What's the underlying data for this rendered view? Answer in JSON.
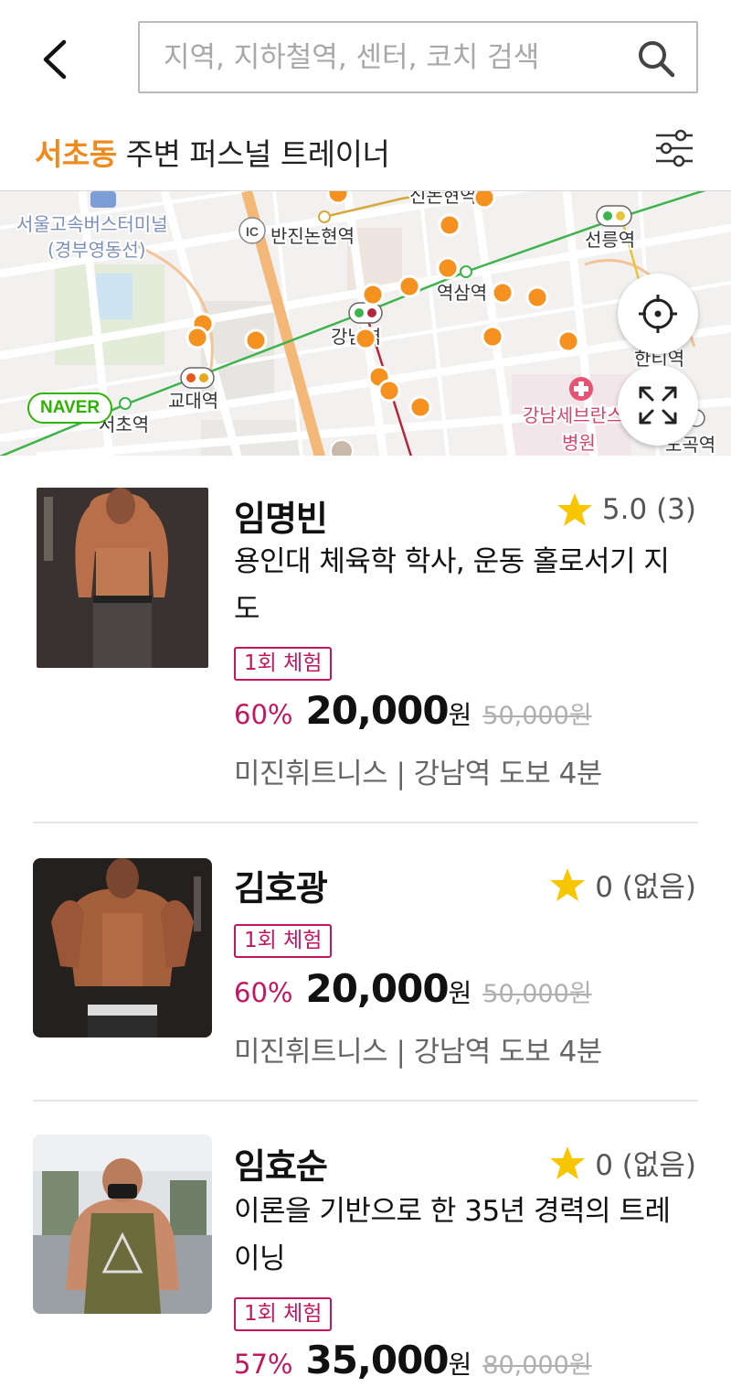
{
  "header": {
    "search_placeholder": "지역, 지하철역, 센터, 코치 검색"
  },
  "area": {
    "name": "서초동",
    "suffix": " 주변 퍼스널 트레이너"
  },
  "map": {
    "brand": "NAVER",
    "labels": {
      "bus_terminal_1": "서울고속버스터미널",
      "bus_terminal_2": "(경부영동선)",
      "ic": "IC",
      "bannonhyeon": "반진논현역",
      "sinnonhyeon": "신논현역",
      "seolleung": "선릉역",
      "yeoksam": "역삼역",
      "gangnam": "강남역",
      "hanti": "한티역",
      "gyodae": "교대역",
      "seocho": "서초역",
      "severance_1": "강남세브란스",
      "severance_2": "병원",
      "dogok": "도곡역"
    },
    "colors": {
      "marker": "#f5911e",
      "line2": "#3cb44b",
      "line9": "#d5a83a",
      "sinbundang": "#b5263d",
      "road": "#f3b878"
    }
  },
  "trainers": [
    {
      "name": "임명빈",
      "rating": "5.0 (3)",
      "description": "용인대 체육학 학사, 운동 홀로서기 지도",
      "badge": "1회 체험",
      "discount": "60%",
      "price": "20,000",
      "currency": "원",
      "original_price": "50,000원",
      "location": "미진휘트니스 | 강남역 도보 4분"
    },
    {
      "name": "김호광",
      "rating": "0 (없음)",
      "badge": "1회 체험",
      "discount": "60%",
      "price": "20,000",
      "currency": "원",
      "original_price": "50,000원",
      "location": "미진휘트니스 | 강남역 도보 4분"
    },
    {
      "name": "임효순",
      "rating": "0 (없음)",
      "description": "이론을 기반으로 한 35년 경력의 트레이닝",
      "badge": "1회 체험",
      "discount": "57%",
      "price": "35,000",
      "currency": "원",
      "original_price": "80,000원"
    }
  ],
  "icons": {
    "back": "chevron-left-icon",
    "search": "search-icon",
    "filter": "sliders-icon",
    "locate": "crosshair-icon",
    "expand": "expand-icon",
    "star": "star-icon"
  },
  "colors": {
    "accent_orange": "#f08a1c",
    "accent_magenta": "#c4165f",
    "star": "#f7c600"
  }
}
